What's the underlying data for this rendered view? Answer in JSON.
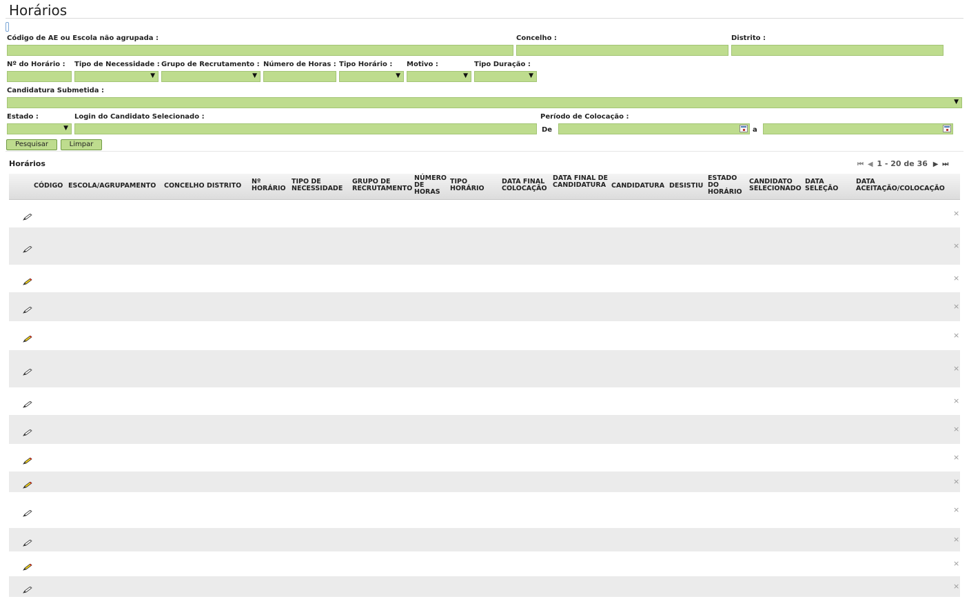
{
  "page": {
    "title": "Horários"
  },
  "filters": {
    "codigo_label": "Código de AE ou Escola não agrupada :",
    "concelho_label": "Concelho :",
    "distrito_label": "Distrito :",
    "num_horario_label": "Nº do Horário :",
    "tipo_necessidade_label": "Tipo de Necessidade :",
    "grupo_recrutamento_label": "Grupo de Recrutamento :",
    "numero_horas_label": "Número de Horas :",
    "tipo_horario_label": "Tipo Horário :",
    "motivo_label": "Motivo :",
    "tipo_duracao_label": "Tipo Duração :",
    "candidatura_label": "Candidatura Submetida :",
    "estado_label": "Estado :",
    "login_label": "Login do Candidato Selecionado :",
    "periodo_label": "Período de Colocação :",
    "de_label": "De",
    "a_label": "a"
  },
  "buttons": {
    "search": "Pesquisar",
    "clear": "Limpar"
  },
  "results": {
    "title": "Horários",
    "pager": "1 - 20 de 36",
    "columns": [
      "CÓDIGO",
      "ESCOLA/AGRUPAMENTO",
      "CONCELHO",
      "DISTRITO",
      "Nº HORÁRIO",
      "TIPO DE NECESSIDADE",
      "GRUPO DE RECRUTAMENTO",
      "NÚMERO DE HORAS",
      "TIPO HORÁRIO",
      "DATA FINAL COLOCAÇÃO",
      "DATA FINAL DE CANDIDATURA",
      "CANDIDATURA",
      "DESISTIU",
      "ESTADO DO HORÁRIO",
      "CANDIDATO SELECIONADO",
      "DATA SELEÇÃO",
      "DATA ACEITAÇÃO/COLOCAÇÃO"
    ],
    "rows": [
      {
        "color": "blue",
        "edit": "grey",
        "cells": [
          "",
          "",
          "",
          "",
          "",
          "",
          "",
          "",
          "",
          "",
          "",
          "",
          "",
          "",
          "",
          "",
          ""
        ]
      },
      {
        "color": "blue",
        "edit": "grey",
        "cells": [
          "",
          "",
          "",
          "",
          "",
          "",
          "",
          "",
          "",
          "",
          "",
          "",
          "",
          "",
          "",
          "",
          ""
        ]
      },
      {
        "color": "green",
        "edit": "yellow",
        "cells": [
          "",
          "",
          "",
          "",
          "",
          "",
          "",
          "",
          "",
          "",
          "",
          "",
          "",
          "",
          "",
          "",
          ""
        ]
      },
      {
        "color": "blue",
        "edit": "grey",
        "cells": [
          "",
          "",
          "",
          "",
          "",
          "",
          "",
          "",
          "",
          "",
          "",
          "",
          "",
          "",
          "",
          "",
          ""
        ]
      },
      {
        "color": "green",
        "edit": "yellow",
        "cells": [
          "",
          "",
          "",
          "",
          "",
          "",
          "",
          "",
          "",
          "",
          "",
          "",
          "",
          "",
          "",
          "",
          ""
        ]
      },
      {
        "color": "blue",
        "edit": "grey",
        "cells": [
          "",
          "",
          "",
          "",
          "",
          "",
          "",
          "",
          "",
          "",
          "",
          "",
          "",
          "",
          "",
          "",
          ""
        ]
      },
      {
        "color": "blue",
        "edit": "grey",
        "cells": [
          "",
          "",
          "",
          "",
          "",
          "",
          "",
          "",
          "",
          "",
          "",
          "",
          "",
          "",
          "",
          "",
          ""
        ]
      },
      {
        "color": "blue",
        "edit": "grey",
        "cells": [
          "",
          "",
          "",
          "",
          "",
          "",
          "",
          "",
          "",
          "",
          "",
          "",
          "",
          "",
          "",
          "",
          ""
        ]
      },
      {
        "color": "green",
        "edit": "yellow",
        "cells": [
          "",
          "",
          "",
          "",
          "",
          "",
          "",
          "",
          "",
          "",
          "",
          "",
          "",
          "",
          "",
          "",
          ""
        ]
      },
      {
        "color": "green",
        "edit": "yellow",
        "cells": [
          "",
          "",
          "",
          "",
          "",
          "",
          "",
          "",
          "",
          "",
          "",
          "",
          "",
          "",
          "",
          "",
          ""
        ]
      },
      {
        "color": "blue",
        "edit": "grey",
        "cells": [
          "",
          "",
          "",
          "",
          "",
          "",
          "",
          "",
          "",
          "",
          "",
          "",
          "",
          "",
          "",
          "",
          ""
        ]
      },
      {
        "color": "orange",
        "edit": "grey",
        "cells": [
          "",
          "",
          "",
          "",
          "",
          "",
          "",
          "",
          "",
          "",
          "",
          "",
          "",
          "",
          "",
          "",
          ""
        ]
      },
      {
        "color": "green",
        "edit": "yellow",
        "cells": [
          "",
          "",
          "",
          "",
          "",
          "",
          "",
          "",
          "",
          "",
          "",
          "",
          "",
          "",
          "",
          "",
          ""
        ]
      },
      {
        "color": "blue",
        "edit": "grey",
        "cells": [
          "",
          "",
          "",
          "",
          "",
          "",
          "",
          "",
          "",
          "",
          "",
          "",
          "",
          "",
          "",
          "",
          ""
        ]
      }
    ]
  },
  "colors": {
    "field_bg": "#bedc8e",
    "text_blue": "#5d5de6",
    "text_green": "#3a9a3a",
    "text_orange": "#e0825a"
  }
}
